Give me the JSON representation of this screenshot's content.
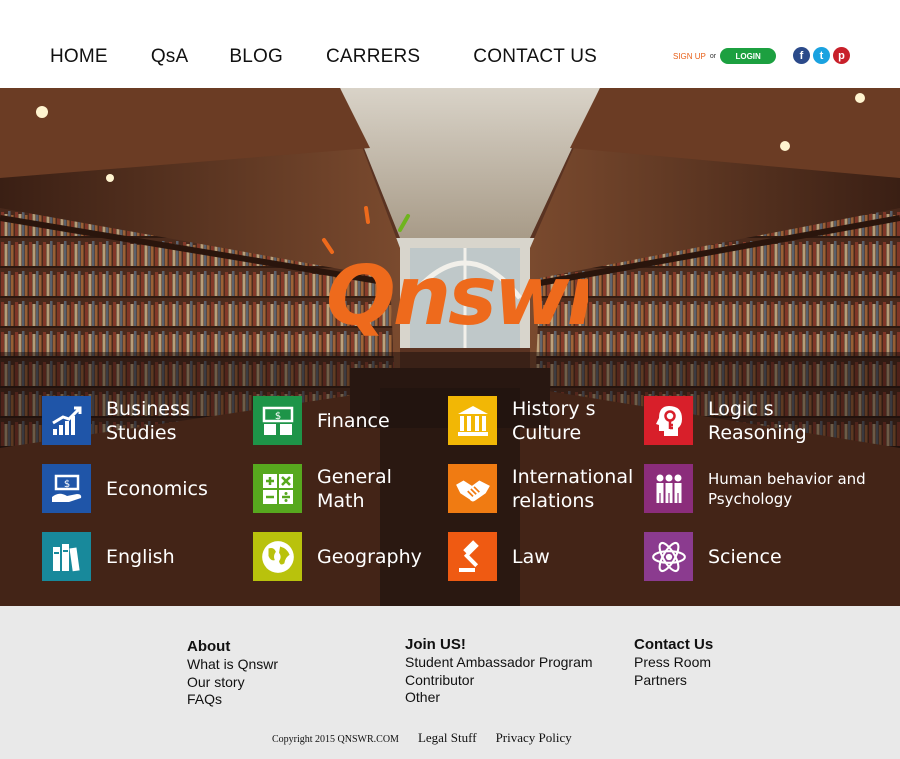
{
  "nav": {
    "items": [
      {
        "label": "HOME"
      },
      {
        "label": "QsA"
      },
      {
        "label": "BLOG"
      },
      {
        "label": "CARRERS"
      },
      {
        "label": "CONTACT US"
      }
    ]
  },
  "auth": {
    "signup_label": "SIGN UP",
    "or_label": "or",
    "login_label": "LOGIN"
  },
  "social": {
    "facebook": {
      "glyph": "f",
      "icon": "facebook-icon",
      "color": "#2b4a8a"
    },
    "twitter": {
      "glyph": "t",
      "icon": "twitter-icon",
      "color": "#1aa2e0"
    },
    "pinterest": {
      "glyph": "p",
      "icon": "pinterest-icon",
      "color": "#c8202a"
    }
  },
  "hero": {
    "logo_text": "Qnswr",
    "logo_color": "#ee6a1c",
    "logo_accent_color": "#6fb41e"
  },
  "categories": [
    {
      "label": "Business\nStudies",
      "icon": "growth-chart-icon",
      "color": "#1f55a8"
    },
    {
      "label": "Economics",
      "icon": "money-hand-icon",
      "color": "#1f55a8"
    },
    {
      "label": "English",
      "icon": "books-icon",
      "color": "#18899b"
    },
    {
      "label": "Finance",
      "icon": "banknotes-icon",
      "color": "#1e9448"
    },
    {
      "label": "General\nMath",
      "icon": "math-operators-icon",
      "color": "#57a81e"
    },
    {
      "label": "Geography",
      "icon": "globe-icon",
      "color": "#b9c20c"
    },
    {
      "label": "History s\nCulture",
      "icon": "museum-icon",
      "color": "#f2b705"
    },
    {
      "label": "International\nrelations",
      "icon": "handshake-icon",
      "color": "#f07b12"
    },
    {
      "label": "Law",
      "icon": "gavel-icon",
      "color": "#ef5a12"
    },
    {
      "label": "Logic s\nReasoning",
      "icon": "head-logic-icon",
      "color": "#d81f2a"
    },
    {
      "label": "Human behavior and\nPsychology",
      "icon": "people-icon",
      "color": "#8b2d7b"
    },
    {
      "label": "Science",
      "icon": "atom-icon",
      "color": "#8b3b8f"
    }
  ],
  "footer": {
    "about": {
      "title": "About",
      "links": [
        "What is Qnswr",
        "Our story",
        "FAQs"
      ]
    },
    "join": {
      "title": "Join US!",
      "links": [
        "Student Ambassador Program",
        "Contributor",
        "Other"
      ]
    },
    "contact": {
      "title": "Contact Us",
      "links": [
        "Press Room",
        "Partners"
      ]
    },
    "copyright": "Copyright 2015 QNSWR.COM",
    "legal": "Legal Stuff",
    "privacy": "Privacy Policy"
  }
}
